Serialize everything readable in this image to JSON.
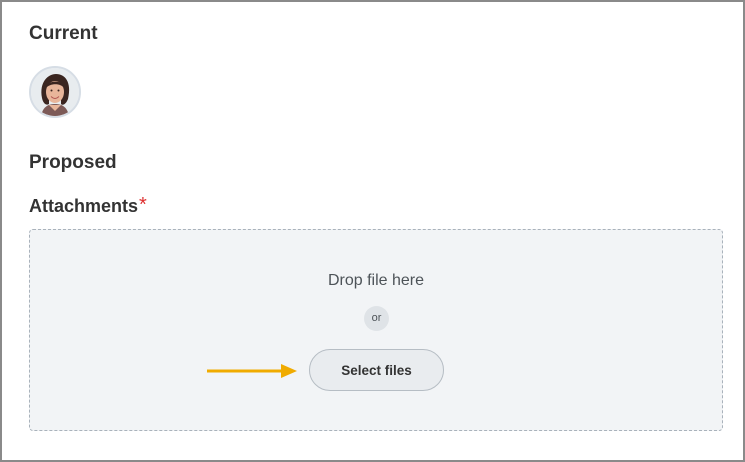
{
  "current": {
    "title": "Current",
    "avatar_icon": "user-photo"
  },
  "proposed": {
    "title": "Proposed"
  },
  "attachments": {
    "label": "Attachments",
    "required_marker": "*",
    "drop_text": "Drop file here",
    "or_text": "or",
    "select_button": "Select files"
  },
  "colors": {
    "required": "#de2f2f",
    "arrow": "#f0ab00",
    "dropzone_bg": "#f2f4f6"
  },
  "annotation_icon": "arrow-right-icon"
}
